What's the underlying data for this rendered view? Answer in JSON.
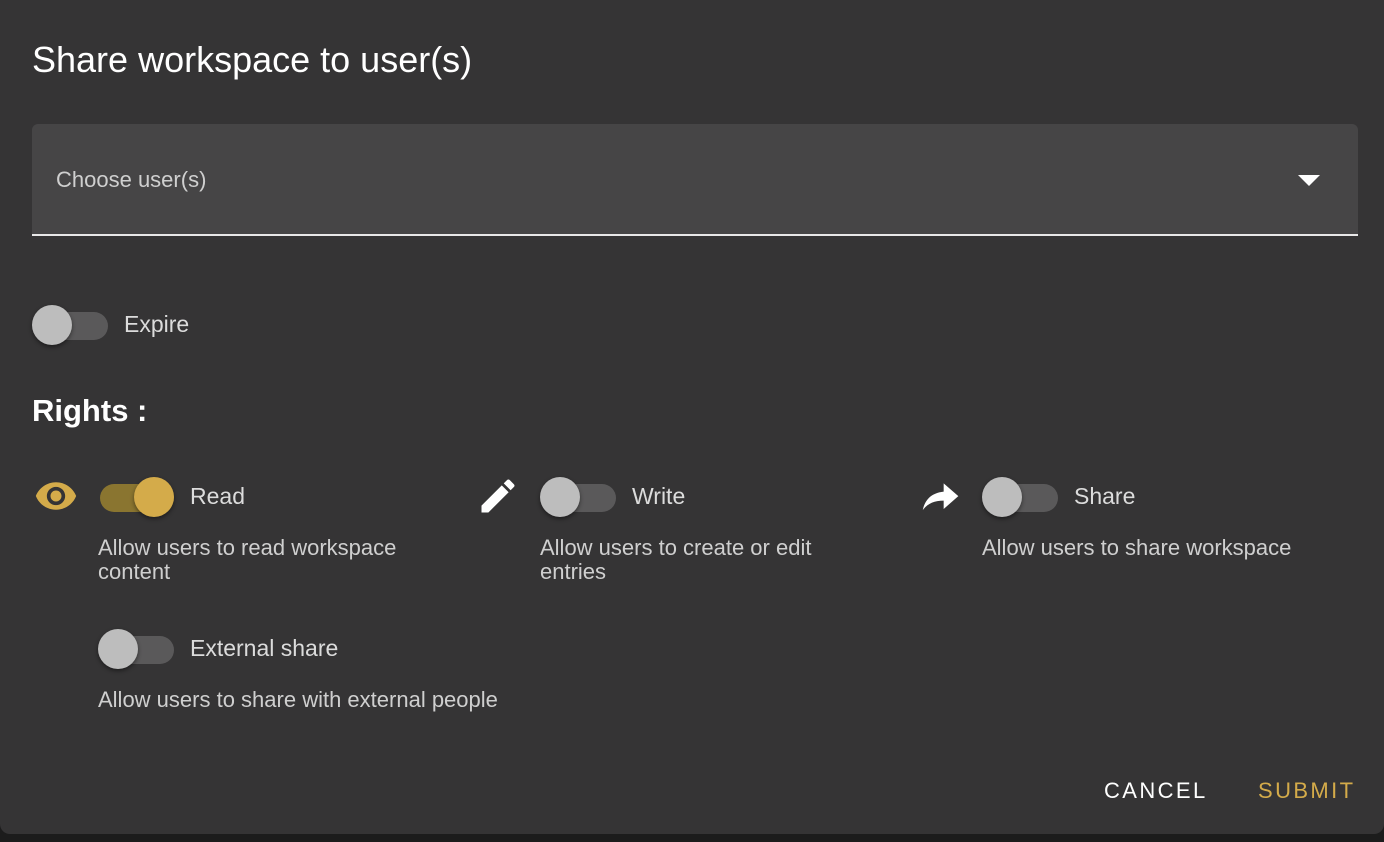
{
  "dialog": {
    "title": "Share workspace to user(s)",
    "user_select": {
      "placeholder": "Choose user(s)"
    },
    "expire": {
      "label": "Expire",
      "enabled": false
    },
    "rights_heading": "Rights :",
    "rights": {
      "read": {
        "icon": "eye-icon",
        "label": "Read",
        "enabled": true,
        "description": "Allow users to read workspace content"
      },
      "write": {
        "icon": "pencil-icon",
        "label": "Write",
        "enabled": false,
        "description": "Allow users to create or edit entries"
      },
      "share": {
        "icon": "share-arrow-icon",
        "label": "Share",
        "enabled": false,
        "description": "Allow users to share workspace"
      },
      "external_share": {
        "label": "External share",
        "enabled": false,
        "description": "Allow users to share with external people"
      }
    },
    "actions": {
      "cancel_label": "CANCEL",
      "submit_label": "SUBMIT"
    }
  },
  "colors": {
    "dialog_background": "#353435",
    "field_background": "#464546",
    "accent": "#d4ab4a",
    "text": "#ffffff"
  }
}
